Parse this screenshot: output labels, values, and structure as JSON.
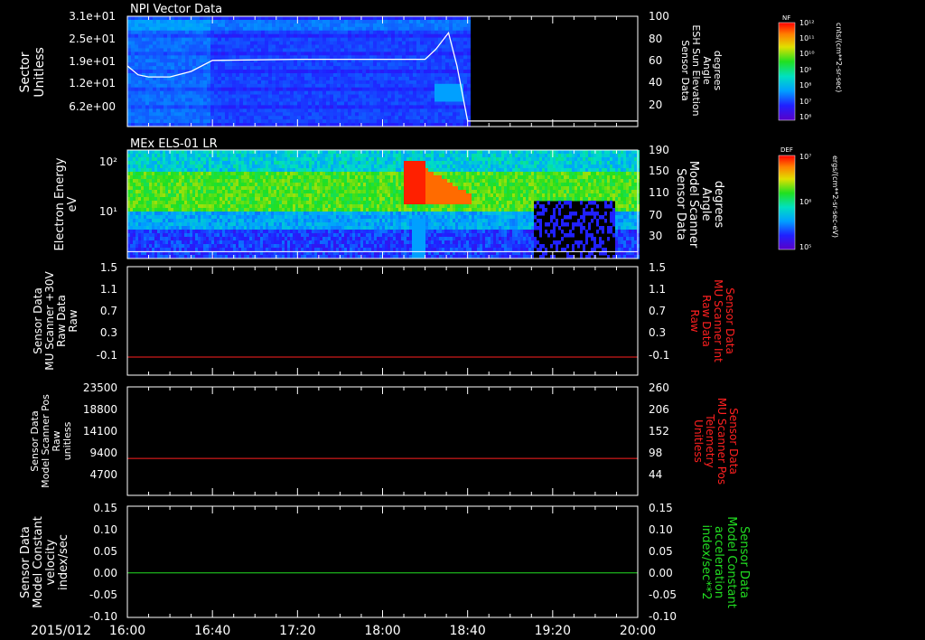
{
  "figure": {
    "date_label": "2015/012",
    "time_ticks": [
      "16:00",
      "16:40",
      "17:20",
      "18:00",
      "18:40",
      "19:20",
      "20:00"
    ]
  },
  "colors": {
    "background": "#000000",
    "axes": "#ffffff",
    "red_trace": "#ff2020",
    "green_trace": "#22dd22",
    "red_label": "#ff2020",
    "green_label": "#22dd22"
  },
  "panel1": {
    "title": "NPI Vector Data",
    "ylabel_line1": "Sector",
    "ylabel_line2": "Unitless",
    "y_ticks": [
      "3.1e+01",
      "2.5e+01",
      "1.9e+01",
      "1.2e+01",
      "6.2e+00"
    ],
    "right_ticks": [
      "100",
      "80",
      "60",
      "40",
      "20"
    ],
    "right_label": [
      "Sensor Data",
      "ESH Sun Elevation",
      "Angle",
      "degrees"
    ],
    "colorbar_title": "NF",
    "colorbar_ticks": [
      "10¹²",
      "10¹¹",
      "10¹⁰",
      "10⁹",
      "10⁸",
      "10⁷",
      "10⁶"
    ],
    "colorbar_unit": "cnts/(cm**2-sr-sec)"
  },
  "panel2": {
    "title": "MEx ELS-01 LR",
    "ylabel_line1": "Electron Energy",
    "ylabel_line2": "eV",
    "y_ticks": [
      "10²",
      "10¹"
    ],
    "right_ticks": [
      "190",
      "150",
      "110",
      "70",
      "30"
    ],
    "right_label": [
      "Sensor Data",
      "Model Scanner",
      "Angle",
      "degrees"
    ],
    "colorbar_title": "DEF",
    "colorbar_ticks": [
      "10⁷",
      "10⁶",
      "10⁵"
    ],
    "colorbar_unit": "ergs/(cm**2-sr-sec-eV)"
  },
  "panel3": {
    "left_label": [
      "Sensor Data",
      "MU Scanner +30V",
      "Raw Data",
      "Raw"
    ],
    "left_ticks": [
      "1.5",
      "1.1",
      "0.7",
      "0.3",
      "-0.1"
    ],
    "right_ticks": [
      "1.5",
      "1.1",
      "0.7",
      "0.3",
      "-0.1"
    ],
    "right_label": [
      "Sensor Data",
      "MU Scanner Int",
      "Raw Data",
      "Raw"
    ]
  },
  "panel4": {
    "left_label": [
      "Sensor Data",
      "Model Scanner Pos",
      "Raw",
      "unitless"
    ],
    "left_ticks": [
      "23500",
      "18800",
      "14100",
      "9400",
      "4700"
    ],
    "right_ticks": [
      "260",
      "206",
      "152",
      "98",
      "44"
    ],
    "right_label": [
      "Sensor Data",
      "MU Scanner Pos",
      "Telemetry",
      "Unitless"
    ]
  },
  "panel5": {
    "left_label": [
      "Sensor Data",
      "Model Constant",
      "velocity",
      "index/sec"
    ],
    "left_ticks": [
      "0.15",
      "0.10",
      "0.05",
      "0.00",
      "-0.05",
      "-0.10"
    ],
    "right_ticks": [
      "0.15",
      "0.10",
      "0.05",
      "0.00",
      "-0.05",
      "-0.10"
    ],
    "right_label": [
      "Sensor Data",
      "Model Constant",
      "acceleration",
      "index/sec**2"
    ]
  },
  "chart_data": [
    {
      "type": "line",
      "panel": "panel1 overlay",
      "x": [
        "16:00",
        "16:05",
        "16:10",
        "16:20",
        "16:30",
        "16:40",
        "17:20",
        "18:00",
        "18:20",
        "18:25",
        "18:31",
        "18:35",
        "18:40",
        "20:00"
      ],
      "y": [
        55,
        47,
        45,
        45,
        50,
        60,
        61,
        61,
        61,
        70,
        85,
        55,
        5,
        5
      ],
      "ylim": [
        0,
        100
      ]
    },
    {
      "type": "heatmap",
      "panel": "panel1",
      "x_range": [
        "16:00",
        "18:40"
      ],
      "ylim": [
        0,
        31
      ]
    },
    {
      "type": "heatmap",
      "panel": "panel2",
      "x_range": [
        "16:00",
        "20:00"
      ],
      "y_scale": "log",
      "ylim": [
        1,
        200
      ]
    },
    {
      "type": "line",
      "panel": "panel2 overlay",
      "x": [
        "16:00",
        "20:00"
      ],
      "y": [
        12,
        12
      ],
      "ylim": [
        0,
        190
      ]
    },
    {
      "type": "line",
      "panel": "panel3",
      "x": [
        "16:00",
        "20:00"
      ],
      "y": [
        0,
        0
      ],
      "ylim": [
        -0.3,
        1.5
      ]
    },
    {
      "type": "line",
      "panel": "panel4",
      "x": [
        "16:00",
        "20:00"
      ],
      "y": [
        8000,
        8000
      ],
      "ylim": [
        0,
        23500
      ]
    },
    {
      "type": "line",
      "panel": "panel5",
      "x": [
        "16:00",
        "20:00"
      ],
      "y": [
        0,
        0
      ],
      "ylim": [
        -0.1,
        0.15
      ]
    }
  ]
}
